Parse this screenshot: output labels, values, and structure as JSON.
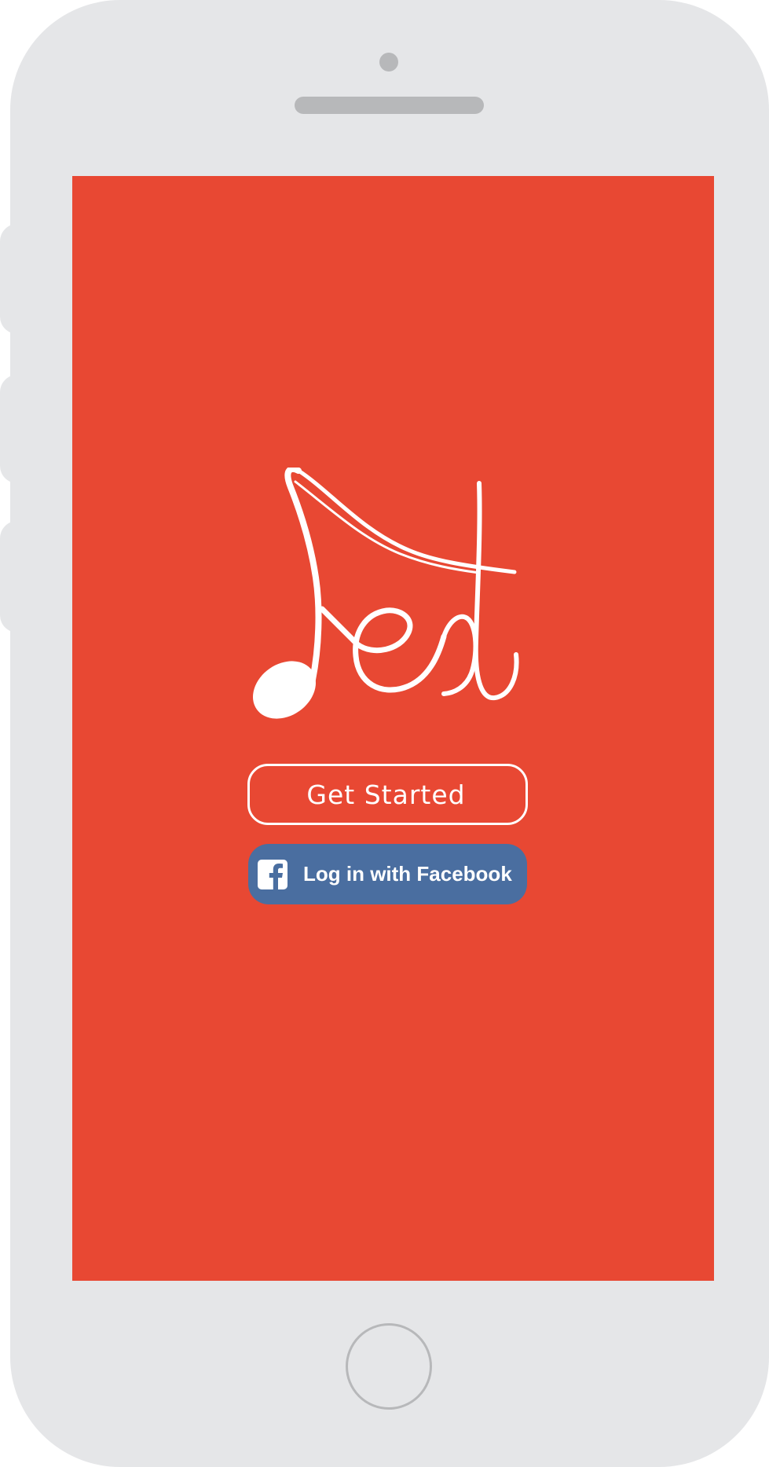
{
  "app": {
    "name": "Fest"
  },
  "colors": {
    "screen_background": "#e84833",
    "device_body": "#e5e6e8",
    "device_details": "#b7b8ba",
    "facebook_blue": "#4a6ea0",
    "foreground": "#ffffff"
  },
  "logo": {
    "icon": "music-note-fest-logo"
  },
  "buttons": {
    "get_started_label": "Get Started",
    "facebook_label": "Log in with Facebook",
    "facebook_icon": "facebook-icon"
  }
}
